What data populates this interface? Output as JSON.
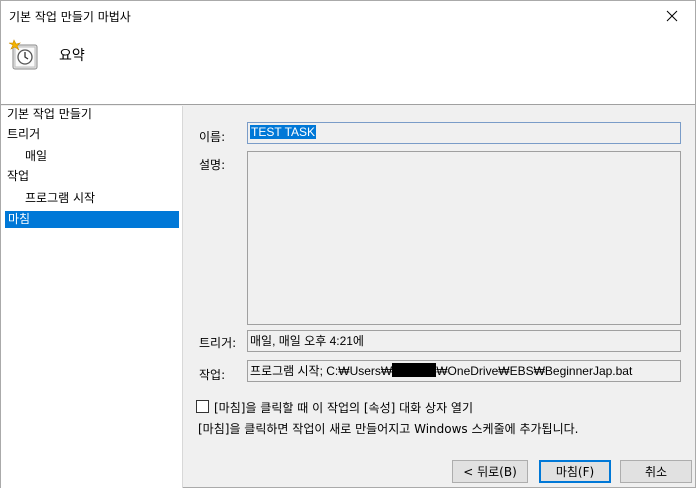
{
  "window": {
    "title": "기본 작업 만들기 마법사",
    "close_glyph": "✕"
  },
  "header": {
    "title": "요약",
    "icon": "task-clock-icon"
  },
  "sidebar": {
    "items": [
      {
        "label": "기본 작업 만들기"
      },
      {
        "label": "트리거"
      },
      {
        "label": "매일"
      },
      {
        "label": "작업"
      },
      {
        "label": "프로그램 시작"
      },
      {
        "label": "마침"
      }
    ],
    "selected": "마침"
  },
  "form": {
    "name_label": "이름:",
    "name_value": "TEST TASK",
    "description_label": "설명:",
    "description_value": "",
    "trigger_label": "트리거:",
    "trigger_value": "매일, 매일 오후 4:21에",
    "action_label": "작업:",
    "action_value_prefix": "프로그램 시작; C:₩Users₩",
    "action_value_suffix": "₩OneDrive₩EBS₩BeginnerJap.bat",
    "open_properties_checkbox_label": "[마침]을 클릭할 때 이 작업의 [속성] 대화 상자 열기",
    "open_properties_checked": false,
    "info_text": "[마침]을 클릭하면 작업이 새로 만들어지고 Windows 스케줄에 추가됩니다."
  },
  "buttons": {
    "back": "< 뒤로(B)",
    "finish": "마침(F)",
    "cancel": "취소"
  },
  "colors": {
    "selection": "#0078d7",
    "dialog_bg": "#f0f0f0"
  }
}
